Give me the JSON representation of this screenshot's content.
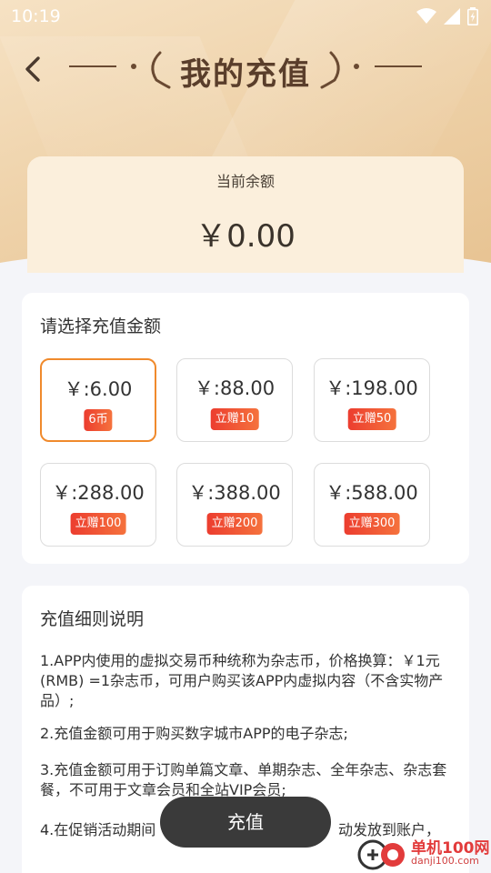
{
  "status_bar": {
    "time": "10:19"
  },
  "header": {
    "title": "我的充值"
  },
  "balance": {
    "label": "当前余额",
    "value": "￥0.00"
  },
  "recharge": {
    "section_title": "请选择充值金额",
    "options": [
      {
        "price": "￥:6.00",
        "badge": "6币",
        "selected": true
      },
      {
        "price": "￥:88.00",
        "badge": "立赠10",
        "selected": false
      },
      {
        "price": "￥:198.00",
        "badge": "立赠50",
        "selected": false
      },
      {
        "price": "￥:288.00",
        "badge": "立赠100",
        "selected": false
      },
      {
        "price": "￥:388.00",
        "badge": "立赠200",
        "selected": false
      },
      {
        "price": "￥:588.00",
        "badge": "立赠300",
        "selected": false
      }
    ]
  },
  "rules": {
    "title": "充值细则说明",
    "items": [
      "1.APP内使用的虚拟交易币种统称为杂志币，价格换算：￥1元 (RMB) =1杂志币，可用户购买该APP内虚拟内容（不含实物产品）;",
      "2.充值金额可用于购买数字城市APP的电子杂志;",
      "3.充值金额可用于订购单篇文章、单期杂志、全年杂志、杂志套餐，不可用于文章会员和全站VIP会员;",
      "4.在促销活动期间",
      "动发放到账户，"
    ]
  },
  "button": {
    "label": "充值"
  },
  "watermark": {
    "name": "单机100网",
    "url": "danji100.com"
  },
  "colors": {
    "accent": "#f08a2c",
    "badge": "#ec3d2f",
    "button": "#3a3a3a"
  }
}
